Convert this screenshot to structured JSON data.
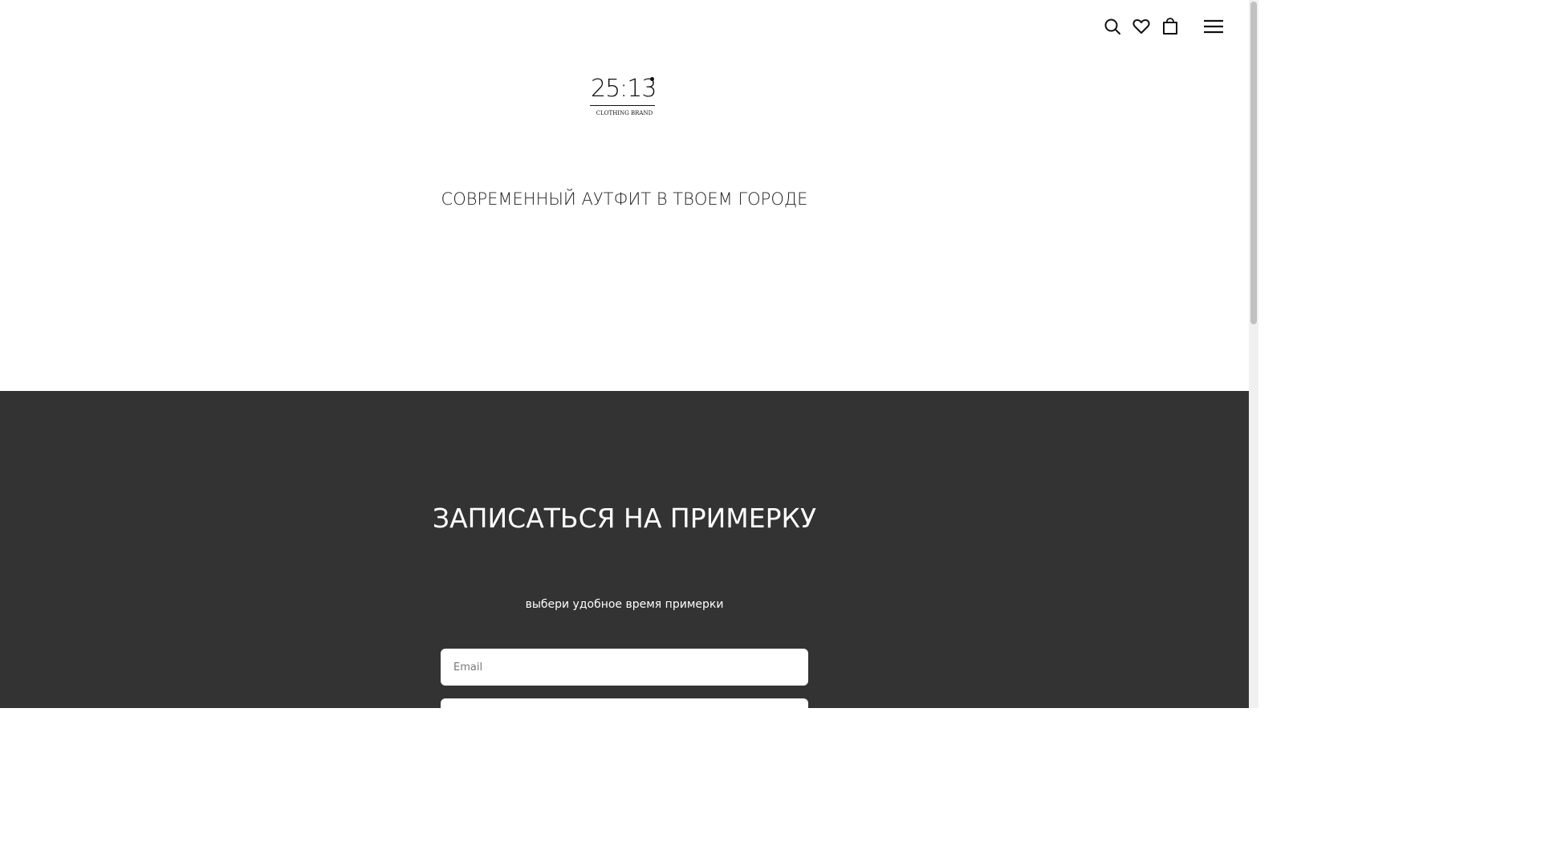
{
  "header": {
    "icons": [
      "search-icon",
      "heart-icon",
      "bag-icon",
      "menu-icon"
    ]
  },
  "logo": {
    "digits": "25:13",
    "subtitle": "CLOTHING BRAND"
  },
  "hero": {
    "title": "СОВРЕМЕННЫЙ АУТФИТ В ТВОЕМ ГОРОДЕ"
  },
  "signup": {
    "title": "ЗАПИСАТЬСЯ НА ПРИМЕРКУ",
    "subtitle": "выбери удобное время примерки",
    "email_placeholder": "Email"
  },
  "colors": {
    "dark_section": "#333333",
    "text_dark": "#111111",
    "text_light": "#ffffff"
  }
}
